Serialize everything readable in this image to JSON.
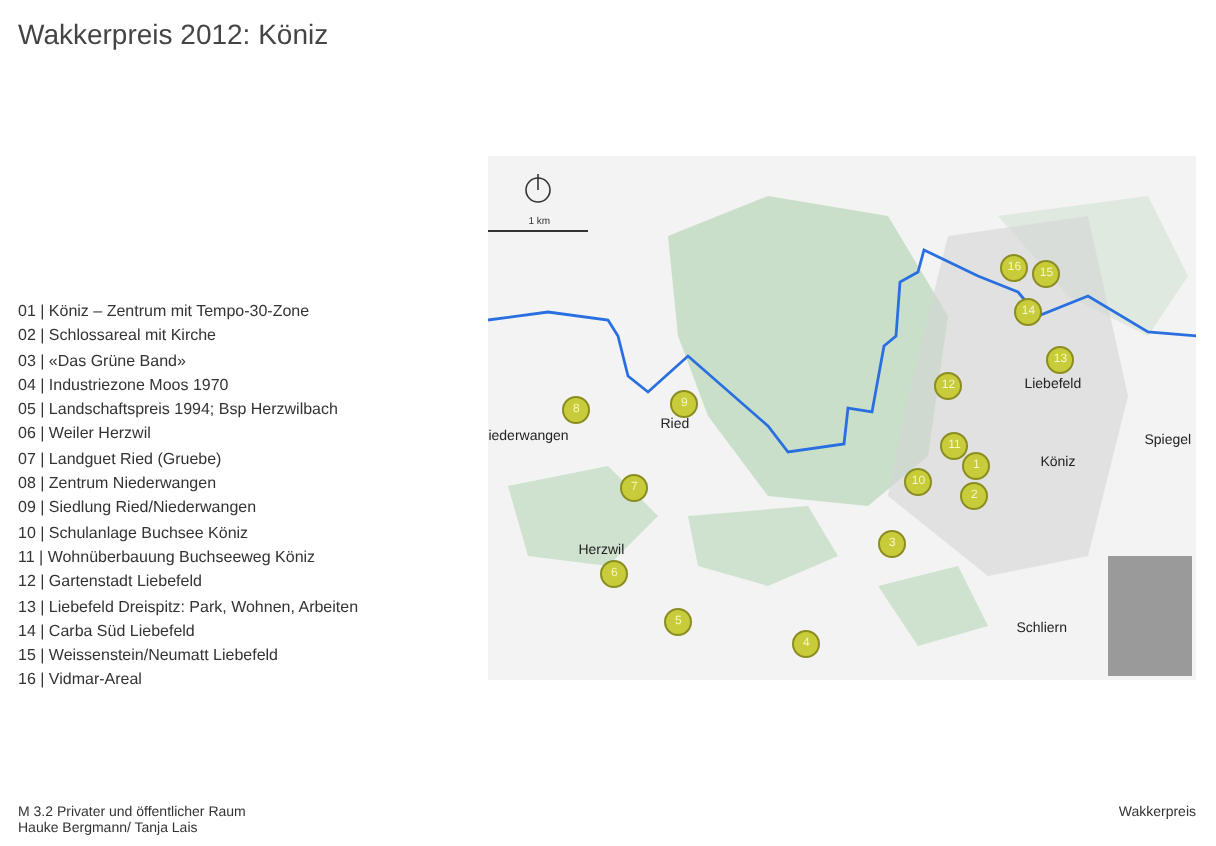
{
  "title": "Wakkerpreis 2012: Köniz",
  "list": [
    "01 | Köniz – Zentrum mit Tempo-30-Zone",
    "02 | Schlossareal mit Kirche",
    "03 | «Das Grüne Band»",
    "04 | Industriezone Moos 1970",
    "05 | Landschaftspreis 1994; Bsp Herzwilbach",
    "06 | Weiler Herzwil",
    "07 | Landguet Ried (Gruebe)",
    "08 | Zentrum Niederwangen",
    "09 | Siedlung Ried/Niederwangen",
    "10 | Schulanlage Buchsee Köniz",
    "11 | Wohnüberbauung Buchseeweg Köniz",
    "12 | Gartenstadt Liebefeld",
    "13 | Liebefeld Dreispitz: Park, Wohnen, Arbeiten",
    "14 | Carba Süd Liebefeld",
    "15 | Weissenstein/Neumatt Liebefeld",
    "16 | Vidmar-Areal"
  ],
  "map": {
    "scale_label": "1 km",
    "places": [
      "iederwangen",
      "Ried",
      "Herzwil",
      "Liebefeld",
      "Köniz",
      "Spiegel",
      "Schliern"
    ],
    "markers": [
      "1",
      "2",
      "3",
      "4",
      "5",
      "6",
      "7",
      "8",
      "9",
      "10",
      "11",
      "12",
      "13",
      "14",
      "15",
      "16"
    ]
  },
  "footer": {
    "left": [
      "M 3.2 Privater und öffentlicher Raum",
      "Hauke Bergmann/ Tanja Lais"
    ],
    "right": "Wakkerpreis"
  }
}
